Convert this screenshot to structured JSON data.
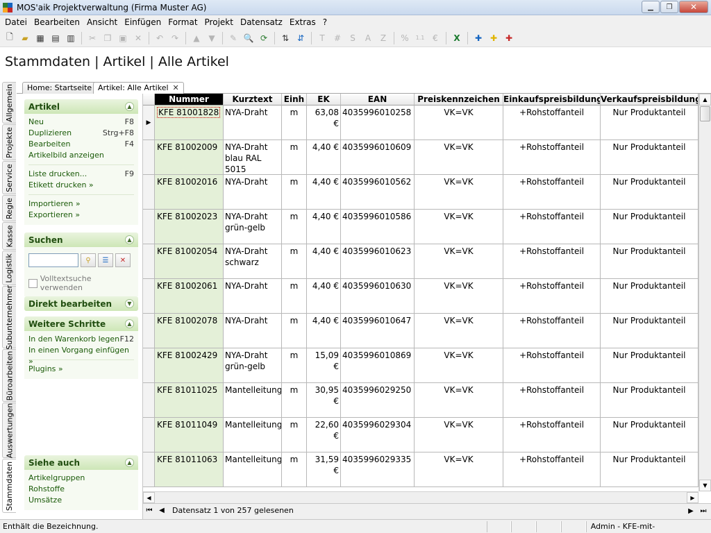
{
  "window": {
    "title": "MOS'aik Projektverwaltung (Firma Muster AG)"
  },
  "menu": [
    "Datei",
    "Bearbeiten",
    "Ansicht",
    "Einfügen",
    "Format",
    "Projekt",
    "Datensatz",
    "Extras",
    "?"
  ],
  "page": {
    "title": "Stammdaten | Artikel | Alle Artikel"
  },
  "vtabs": [
    "Allgemein",
    "Projekte",
    "Service",
    "Regie",
    "Kasse",
    "Logistik",
    "Subunternehmer",
    "Büroarbeiten",
    "Auswertungen",
    "Stammdaten"
  ],
  "doctabs": [
    {
      "label": "Home: Startseite"
    },
    {
      "label": "Artikel: Alle Artikel"
    }
  ],
  "panels": {
    "artikel": {
      "title": "Artikel",
      "items": [
        {
          "label": "Neu",
          "key": "F8"
        },
        {
          "label": "Duplizieren",
          "key": "Strg+F8"
        },
        {
          "label": "Bearbeiten",
          "key": "F4"
        },
        {
          "label": "Artikelbild anzeigen",
          "key": ""
        }
      ],
      "items2": [
        {
          "label": "Liste drucken...",
          "key": "F9"
        },
        {
          "label": "Etikett drucken »",
          "key": ""
        }
      ],
      "items3": [
        {
          "label": "Importieren »",
          "key": ""
        },
        {
          "label": "Exportieren »",
          "key": ""
        }
      ]
    },
    "suchen": {
      "title": "Suchen",
      "search_value": "",
      "fulltext_label": "Volltextsuche verwenden"
    },
    "direkt": {
      "title": "Direkt bearbeiten"
    },
    "weitere": {
      "title": "Weitere Schritte",
      "items": [
        {
          "label": "In den Warenkorb legen",
          "key": "F12"
        },
        {
          "label": "In einen Vorgang einfügen »",
          "key": ""
        }
      ],
      "items2": [
        {
          "label": "Plugins »",
          "key": ""
        }
      ]
    },
    "siehe": {
      "title": "Siehe auch",
      "items": [
        {
          "label": "Artikelgruppen"
        },
        {
          "label": "Rohstoffe"
        },
        {
          "label": "Umsätze"
        }
      ]
    }
  },
  "grid": {
    "columns": [
      "Nummer",
      "Kurztext",
      "Einh",
      "EK",
      "EAN",
      "Preiskennzeichen",
      "Einkaufspreisbildung",
      "Verkaufspreisbildung"
    ],
    "rows": [
      {
        "nummer": "KFE 81001828",
        "kurztext": "NYA-Draht",
        "einh": "m",
        "ek": "63,08 €",
        "ean": "4035996010258",
        "pkz": "VK=VK",
        "ekb": "+Rohstoffanteil",
        "vkb": "Nur Produktanteil"
      },
      {
        "nummer": "KFE 81002009",
        "kurztext": "NYA-Draht blau RAL 5015",
        "einh": "m",
        "ek": "4,40 €",
        "ean": "4035996010609",
        "pkz": "VK=VK",
        "ekb": "+Rohstoffanteil",
        "vkb": "Nur Produktanteil"
      },
      {
        "nummer": "KFE 81002016",
        "kurztext": "NYA-Draht",
        "einh": "m",
        "ek": "4,40 €",
        "ean": "4035996010562",
        "pkz": "VK=VK",
        "ekb": "+Rohstoffanteil",
        "vkb": "Nur Produktanteil"
      },
      {
        "nummer": "KFE 81002023",
        "kurztext": "NYA-Draht grün-gelb",
        "einh": "m",
        "ek": "4,40 €",
        "ean": "4035996010586",
        "pkz": "VK=VK",
        "ekb": "+Rohstoffanteil",
        "vkb": "Nur Produktanteil"
      },
      {
        "nummer": "KFE 81002054",
        "kurztext": "NYA-Draht schwarz",
        "einh": "m",
        "ek": "4,40 €",
        "ean": "4035996010623",
        "pkz": "VK=VK",
        "ekb": "+Rohstoffanteil",
        "vkb": "Nur Produktanteil"
      },
      {
        "nummer": "KFE 81002061",
        "kurztext": "NYA-Draht",
        "einh": "m",
        "ek": "4,40 €",
        "ean": "4035996010630",
        "pkz": "VK=VK",
        "ekb": "+Rohstoffanteil",
        "vkb": "Nur Produktanteil"
      },
      {
        "nummer": "KFE 81002078",
        "kurztext": "NYA-Draht",
        "einh": "m",
        "ek": "4,40 €",
        "ean": "4035996010647",
        "pkz": "VK=VK",
        "ekb": "+Rohstoffanteil",
        "vkb": "Nur Produktanteil"
      },
      {
        "nummer": "KFE 81002429",
        "kurztext": "NYA-Draht grün-gelb",
        "einh": "m",
        "ek": "15,09 €",
        "ean": "4035996010869",
        "pkz": "VK=VK",
        "ekb": "+Rohstoffanteil",
        "vkb": "Nur Produktanteil"
      },
      {
        "nummer": "KFE 81011025",
        "kurztext": "Mantelleitung",
        "einh": "m",
        "ek": "30,95 €",
        "ean": "4035996029250",
        "pkz": "VK=VK",
        "ekb": "+Rohstoffanteil",
        "vkb": "Nur Produktanteil"
      },
      {
        "nummer": "KFE 81011049",
        "kurztext": "Mantelleitung",
        "einh": "m",
        "ek": "22,60 €",
        "ean": "4035996029304",
        "pkz": "VK=VK",
        "ekb": "+Rohstoffanteil",
        "vkb": "Nur Produktanteil"
      },
      {
        "nummer": "KFE 81011063",
        "kurztext": "Mantelleitung",
        "einh": "m",
        "ek": "31,59 €",
        "ean": "4035996029335",
        "pkz": "VK=VK",
        "ekb": "+Rohstoffanteil",
        "vkb": "Nur Produktanteil"
      }
    ]
  },
  "navigator": {
    "text": "Datensatz 1 von 257 gelesenen"
  },
  "status": {
    "left": "Enthält die Bezeichnung.",
    "right": "Admin - KFE-mit-Stückliste.mdb"
  },
  "colors": {
    "accent_green": "#cde6b6",
    "link_green": "#1a5a08",
    "nummer_column_bg": "#e4f0d8"
  }
}
